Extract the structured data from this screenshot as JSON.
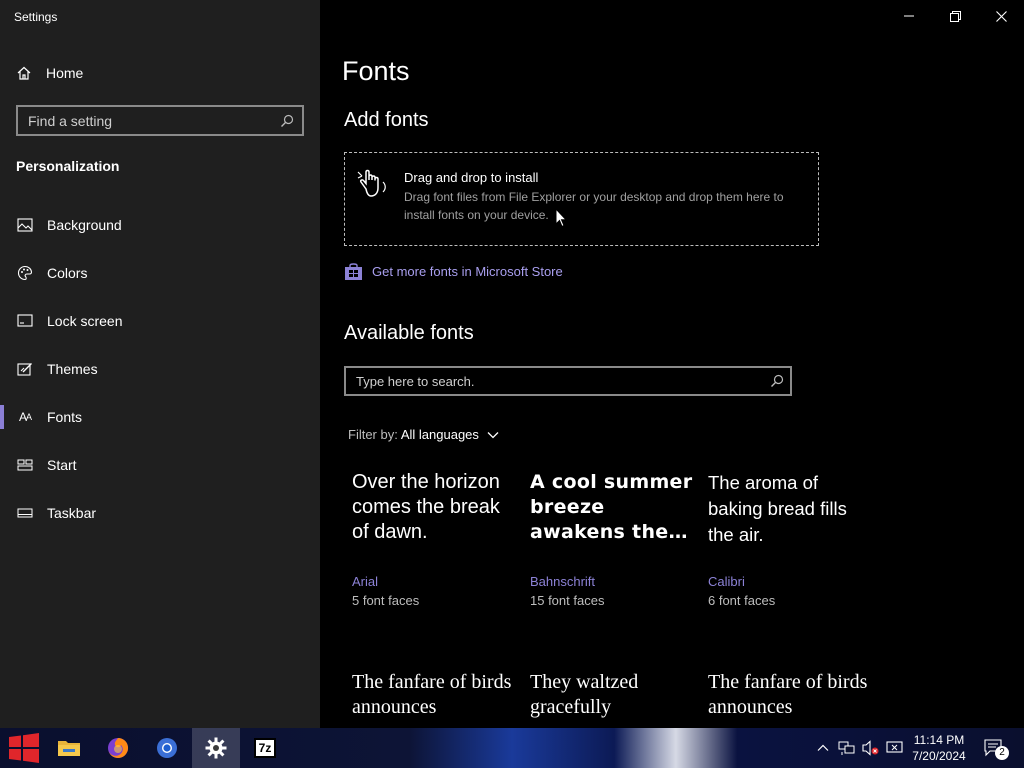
{
  "window": {
    "title": "Settings"
  },
  "sidebar": {
    "home_label": "Home",
    "search_placeholder": "Find a setting",
    "section": "Personalization",
    "items": [
      {
        "label": "Background",
        "icon": "image-icon"
      },
      {
        "label": "Colors",
        "icon": "palette-icon"
      },
      {
        "label": "Lock screen",
        "icon": "lock-screen-icon"
      },
      {
        "label": "Themes",
        "icon": "themes-icon"
      },
      {
        "label": "Fonts",
        "icon": "fonts-icon",
        "active": true
      },
      {
        "label": "Start",
        "icon": "start-icon"
      },
      {
        "label": "Taskbar",
        "icon": "taskbar-icon"
      }
    ]
  },
  "main": {
    "title": "Fonts",
    "add_fonts": {
      "heading": "Add fonts",
      "drop_title": "Drag and drop to install",
      "drop_desc": "Drag font files from File Explorer or your desktop and drop them here to install fonts on your device.",
      "store_link": "Get more fonts in Microsoft Store"
    },
    "available": {
      "heading": "Available fonts",
      "search_placeholder": "Type here to search.",
      "filter_label": "Filter by:",
      "filter_value": "All languages"
    },
    "fonts": [
      {
        "sample": "Over the horizon comes the break of dawn.",
        "name": "Arial",
        "faces": "5 font faces"
      },
      {
        "sample": "A cool summer breeze awakens the…",
        "name": "Bahnschrift",
        "faces": "15 font faces"
      },
      {
        "sample": "The aroma of baking bread fills the air.",
        "name": "Calibri",
        "faces": "6 font faces"
      },
      {
        "sample": "The fanfare of birds announces",
        "name": "",
        "faces": ""
      },
      {
        "sample": "They waltzed gracefully",
        "name": "",
        "faces": ""
      },
      {
        "sample": "The fanfare of birds announces",
        "name": "",
        "faces": ""
      }
    ]
  },
  "taskbar": {
    "apps": [
      "start-icon",
      "file-explorer-icon",
      "firefox-icon",
      "chrome-icon",
      "settings-icon",
      "7zip-icon"
    ],
    "seven_zip_label": "7z",
    "clock_time": "11:14 PM",
    "clock_date": "7/20/2024",
    "notification_count": "2"
  },
  "colors": {
    "accent": "#8b7fd6",
    "link": "#a99fef",
    "sidebar_bg": "#1f1f1f"
  }
}
